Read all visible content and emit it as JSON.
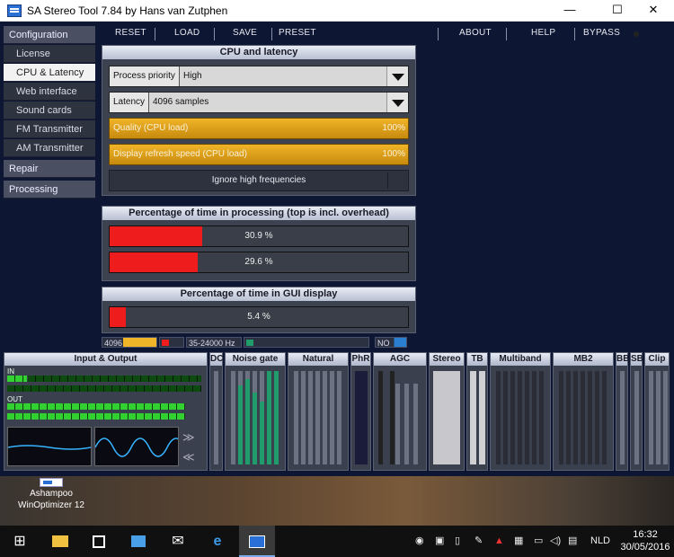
{
  "window": {
    "title": "SA Stereo Tool 7.84 by Hans van Zutphen",
    "minimize": "—",
    "maximize": "☐",
    "close": "✕"
  },
  "sidebar": {
    "items": [
      {
        "label": "Configuration"
      },
      {
        "label": "License"
      },
      {
        "label": "CPU & Latency"
      },
      {
        "label": "Web interface"
      },
      {
        "label": "Sound cards"
      },
      {
        "label": "FM Transmitter"
      },
      {
        "label": "AM Transmitter"
      },
      {
        "label": "Repair"
      },
      {
        "label": "Processing"
      }
    ]
  },
  "toolbar": {
    "reset": "RESET",
    "load": "LOAD",
    "save": "SAVE",
    "preset": "PRESET",
    "about": "ABOUT",
    "help": "HELP",
    "bypass": "BYPASS"
  },
  "cpu_panel": {
    "title": "CPU and latency",
    "priority_label": "Process priority",
    "priority_value": "High",
    "latency_label": "Latency",
    "latency_value": "4096 samples",
    "quality_label": "Quality (CPU load)",
    "quality_value": "100%",
    "refresh_label": "Display refresh speed (CPU load)",
    "refresh_value": "100%",
    "ignore_button": "Ignore high frequencies"
  },
  "processing_panel": {
    "title": "Percentage of time in processing (top is incl. overhead)",
    "bar1_text": "30.9 %",
    "bar1_fraction": 0.309,
    "bar2_text": "29.6 %",
    "bar2_fraction": 0.296
  },
  "gui_panel": {
    "title": "Percentage of time in GUI display",
    "bar_text": "5.4 %",
    "bar_fraction": 0.054
  },
  "statusbar": {
    "buffer": "4096",
    "freq": "35-24000 Hz",
    "no": "NO"
  },
  "meters": {
    "io_title": "Input & Output",
    "in_label": "IN",
    "out_label": "OUT",
    "titles": [
      "DC",
      "Noise gate",
      "Natural",
      "PhR",
      "AGC",
      "Stereo",
      "TB",
      "Multiband",
      "MB2",
      "BB",
      "SB",
      "Clip"
    ]
  },
  "desktop": {
    "icon_label_1": "Ashampoo",
    "icon_label_2": "WinOptimizer 12"
  },
  "taskbar": {
    "language": "NLD",
    "time": "16:32",
    "date": "30/05/2016"
  },
  "colors": {
    "accent_orange": "#f0b428",
    "meter_red": "#ee1c1c",
    "led_green": "#32d030"
  }
}
